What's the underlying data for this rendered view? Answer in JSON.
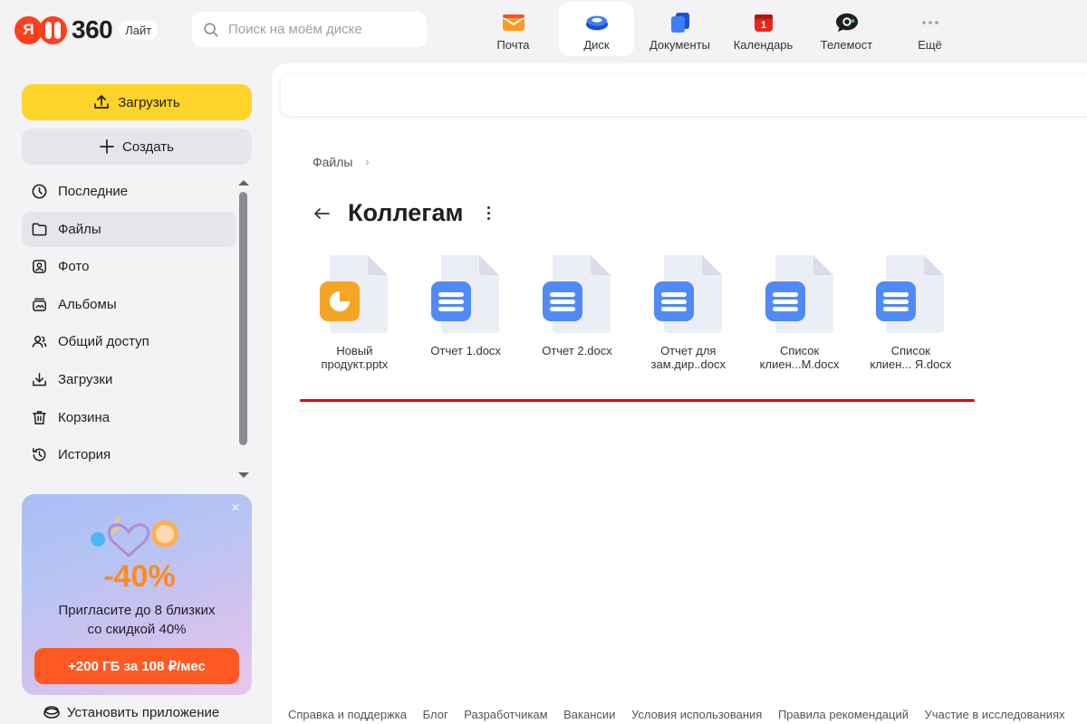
{
  "header": {
    "logo_text": "360",
    "logo_badge": "Лайт",
    "search_placeholder": "Поиск на моём диске",
    "services": [
      {
        "label": "Почта",
        "icon": "mail-icon"
      },
      {
        "label": "Диск",
        "icon": "disk-icon",
        "active": true
      },
      {
        "label": "Документы",
        "icon": "documents-icon"
      },
      {
        "label": "Календарь",
        "icon": "calendar-icon",
        "badge": "1"
      },
      {
        "label": "Телемост",
        "icon": "telemost-icon"
      },
      {
        "label": "Ещё",
        "icon": "more-icon"
      }
    ]
  },
  "sidebar": {
    "upload_label": "Загрузить",
    "create_label": "Создать",
    "items": [
      {
        "label": "Последние",
        "icon": "clock-icon"
      },
      {
        "label": "Файлы",
        "icon": "folder-icon",
        "active": true
      },
      {
        "label": "Фото",
        "icon": "photo-icon"
      },
      {
        "label": "Альбомы",
        "icon": "albums-icon"
      },
      {
        "label": "Общий доступ",
        "icon": "shared-icon"
      },
      {
        "label": "Загрузки",
        "icon": "downloads-icon"
      },
      {
        "label": "Корзина",
        "icon": "trash-icon"
      },
      {
        "label": "История",
        "icon": "history-icon"
      }
    ],
    "promo": {
      "art_text": "-40%",
      "text_line1": "Пригласите до 8 близких",
      "text_line2": "со скидкой 40%",
      "button": "+200 ГБ за 108 ₽/мес"
    },
    "install_label": "Установить приложение"
  },
  "main": {
    "breadcrumb": "Файлы",
    "breadcrumb_sep": "›",
    "title": "Коллегам",
    "files": [
      {
        "name_line1": "Новый",
        "name_line2": "продукт.pptx",
        "type": "pptx",
        "color": "#f5a524"
      },
      {
        "name_line1": "Отчет 1.docx",
        "name_line2": "",
        "type": "docx",
        "color": "#4f8af6"
      },
      {
        "name_line1": "Отчет 2.docx",
        "name_line2": "",
        "type": "docx",
        "color": "#4f8af6"
      },
      {
        "name_line1": "Отчет для",
        "name_line2": "зам.дир..docx",
        "type": "docx",
        "color": "#4f8af6"
      },
      {
        "name_line1": "Список",
        "name_line2": "клиен...М.docx",
        "type": "docx",
        "color": "#4f8af6"
      },
      {
        "name_line1": "Список",
        "name_line2": "клиен... Я.docx",
        "type": "docx",
        "color": "#4f8af6"
      }
    ],
    "underline_color": "#e3000f"
  },
  "footer": {
    "links": [
      "Справка и поддержка",
      "Блог",
      "Разработчикам",
      "Вакансии",
      "Условия использования",
      "Правила рекомендаций",
      "Участие в исследованиях"
    ]
  }
}
